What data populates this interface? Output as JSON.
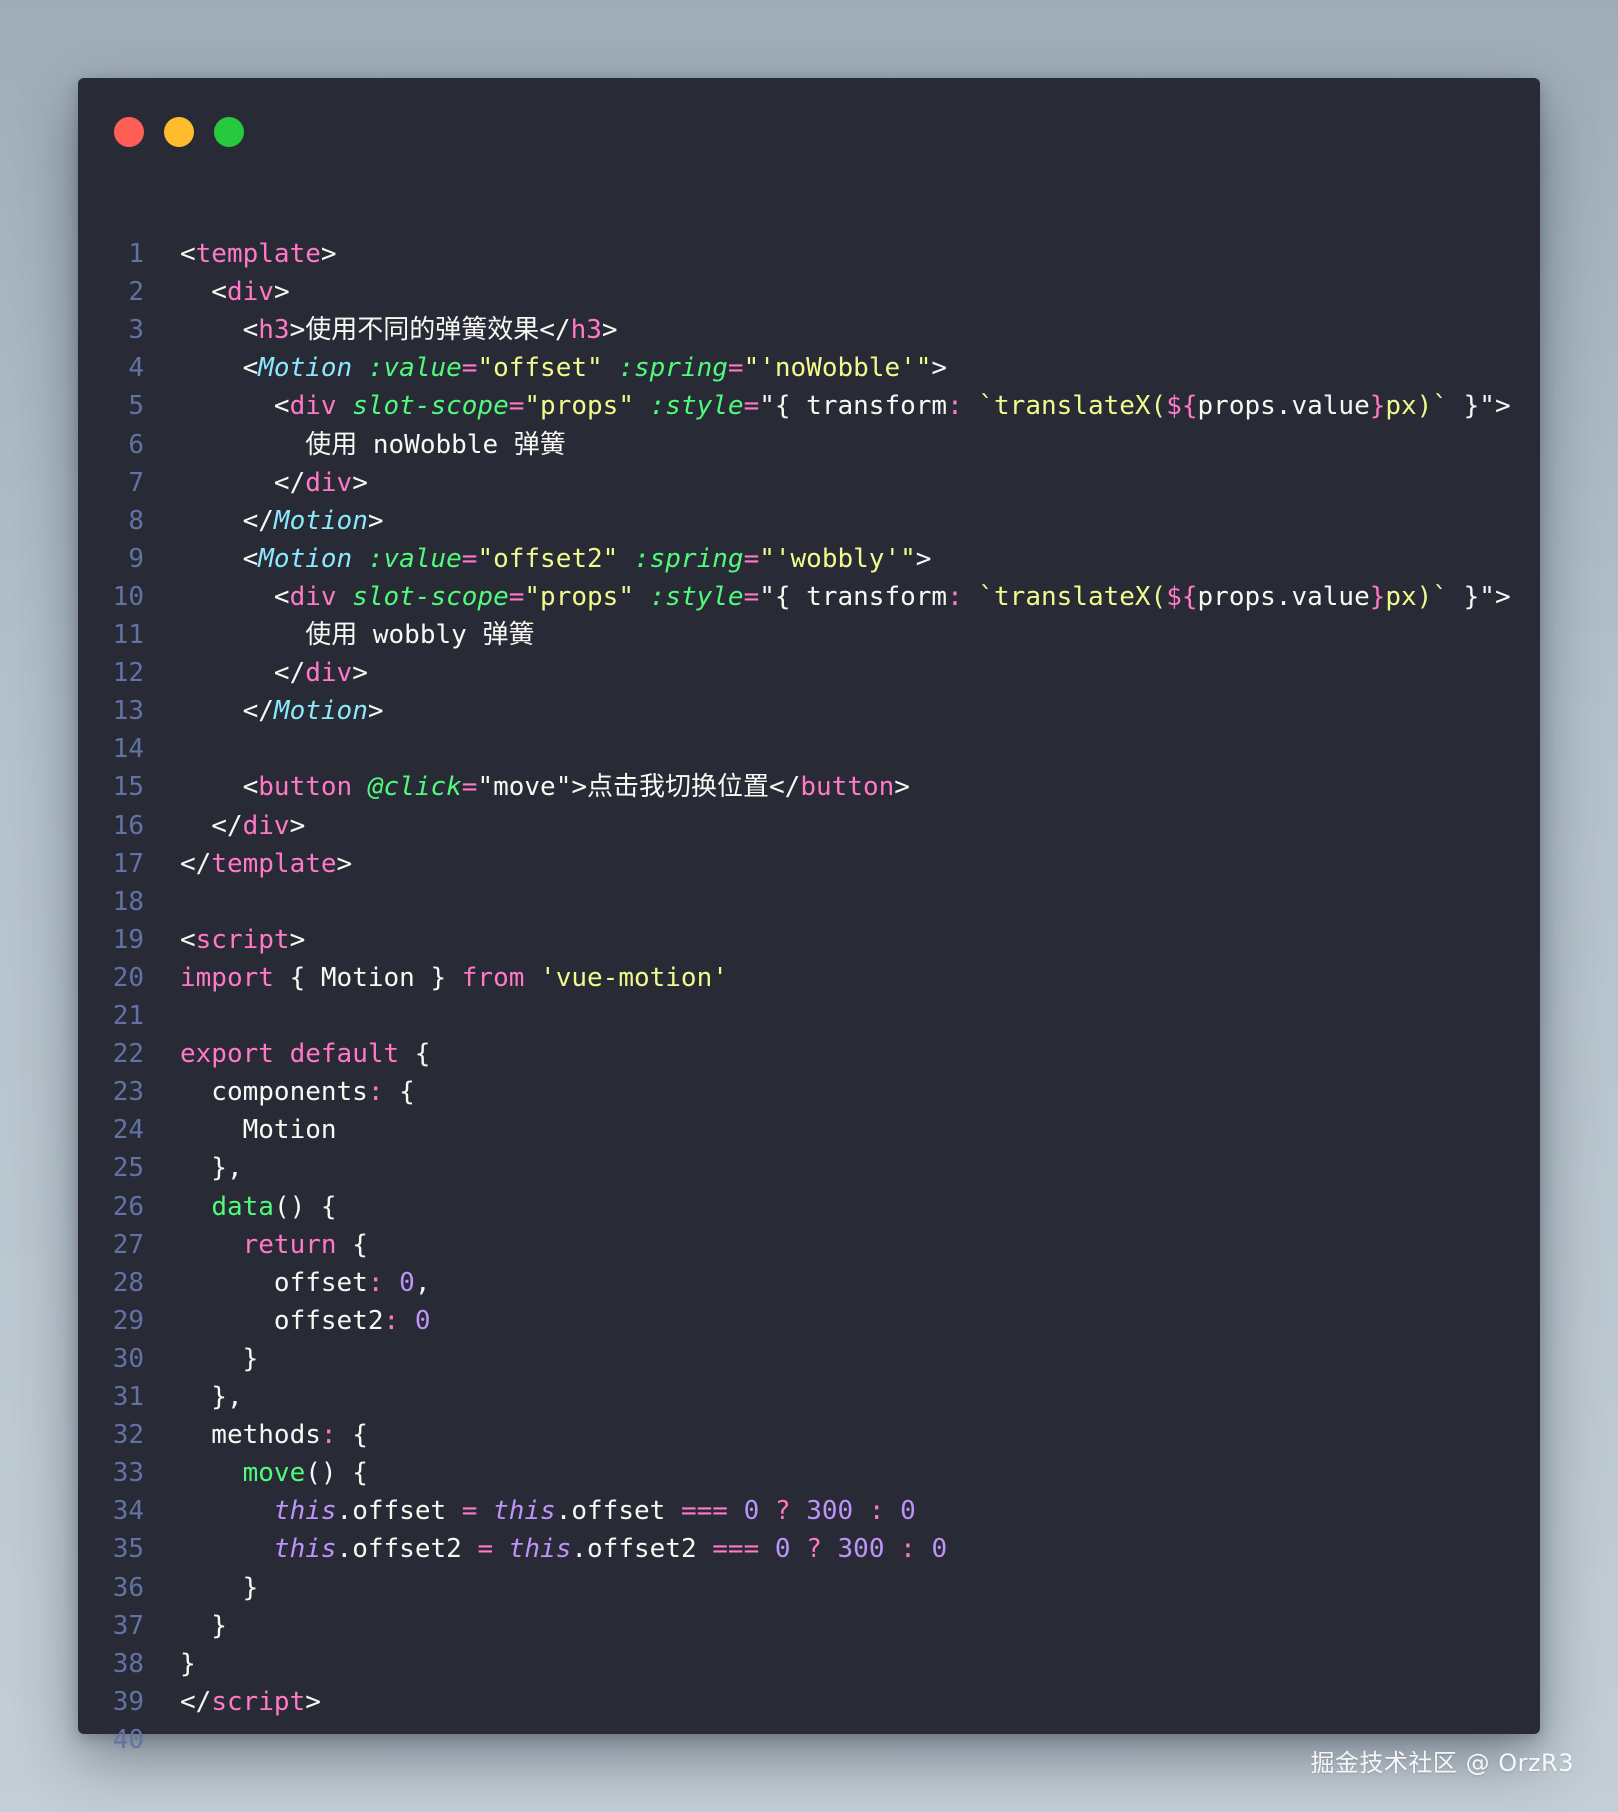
{
  "window": {
    "traffic_lights": [
      {
        "name": "close",
        "color": "#ff5f56"
      },
      {
        "name": "minimize",
        "color": "#ffbd2e"
      },
      {
        "name": "maximize",
        "color": "#27c93f"
      }
    ]
  },
  "theme": {
    "background": "#282a36",
    "line_number": "#6272a4",
    "foreground": "#f8f8f2"
  },
  "code": {
    "lines": [
      {
        "n": "1",
        "tokens": [
          [
            "plain",
            "<"
          ],
          [
            "tag",
            "template"
          ],
          [
            "plain",
            ">"
          ]
        ]
      },
      {
        "n": "2",
        "tokens": [
          [
            "plain",
            "  <"
          ],
          [
            "tag",
            "div"
          ],
          [
            "plain",
            ">"
          ]
        ]
      },
      {
        "n": "3",
        "tokens": [
          [
            "plain",
            "    <"
          ],
          [
            "tag",
            "h3"
          ],
          [
            "plain",
            ">使用不同的弹簧效果</"
          ],
          [
            "tag",
            "h3"
          ],
          [
            "plain",
            ">"
          ]
        ]
      },
      {
        "n": "4",
        "tokens": [
          [
            "plain",
            "    <"
          ],
          [
            "comp",
            "Motion"
          ],
          [
            "plain",
            " "
          ],
          [
            "attr",
            ":value"
          ],
          [
            "op",
            "="
          ],
          [
            "str",
            "\"offset\""
          ],
          [
            "plain",
            " "
          ],
          [
            "attr",
            ":spring"
          ],
          [
            "op",
            "="
          ],
          [
            "str",
            "\"'noWobble'\""
          ],
          [
            "plain",
            ">"
          ]
        ]
      },
      {
        "n": "5",
        "tokens": [
          [
            "plain",
            "      <"
          ],
          [
            "tag",
            "div"
          ],
          [
            "plain",
            " "
          ],
          [
            "attr",
            "slot-scope"
          ],
          [
            "op",
            "="
          ],
          [
            "str",
            "\"props\""
          ],
          [
            "plain",
            " "
          ],
          [
            "attr",
            ":style"
          ],
          [
            "op",
            "="
          ],
          [
            "plain",
            "\"{ transform"
          ],
          [
            "op",
            ":"
          ],
          [
            "plain",
            " "
          ],
          [
            "str",
            "`translateX("
          ],
          [
            "interp",
            "${"
          ],
          [
            "plain",
            "props.value"
          ],
          [
            "interp",
            "}"
          ],
          [
            "str",
            "px)`"
          ],
          [
            "plain",
            " }\">"
          ]
        ]
      },
      {
        "n": "6",
        "tokens": [
          [
            "plain",
            "        使用 noWobble 弹簧"
          ]
        ]
      },
      {
        "n": "7",
        "tokens": [
          [
            "plain",
            "      </"
          ],
          [
            "tag",
            "div"
          ],
          [
            "plain",
            ">"
          ]
        ]
      },
      {
        "n": "8",
        "tokens": [
          [
            "plain",
            "    </"
          ],
          [
            "comp",
            "Motion"
          ],
          [
            "plain",
            ">"
          ]
        ]
      },
      {
        "n": "9",
        "tokens": [
          [
            "plain",
            "    <"
          ],
          [
            "comp",
            "Motion"
          ],
          [
            "plain",
            " "
          ],
          [
            "attr",
            ":value"
          ],
          [
            "op",
            "="
          ],
          [
            "str",
            "\"offset2\""
          ],
          [
            "plain",
            " "
          ],
          [
            "attr",
            ":spring"
          ],
          [
            "op",
            "="
          ],
          [
            "str",
            "\"'wobbly'\""
          ],
          [
            "plain",
            ">"
          ]
        ]
      },
      {
        "n": "10",
        "tokens": [
          [
            "plain",
            "      <"
          ],
          [
            "tag",
            "div"
          ],
          [
            "plain",
            " "
          ],
          [
            "attr",
            "slot-scope"
          ],
          [
            "op",
            "="
          ],
          [
            "str",
            "\"props\""
          ],
          [
            "plain",
            " "
          ],
          [
            "attr",
            ":style"
          ],
          [
            "op",
            "="
          ],
          [
            "plain",
            "\"{ transform"
          ],
          [
            "op",
            ":"
          ],
          [
            "plain",
            " "
          ],
          [
            "str",
            "`translateX("
          ],
          [
            "interp",
            "${"
          ],
          [
            "plain",
            "props.value"
          ],
          [
            "interp",
            "}"
          ],
          [
            "str",
            "px)`"
          ],
          [
            "plain",
            " }\">"
          ]
        ]
      },
      {
        "n": "11",
        "tokens": [
          [
            "plain",
            "        使用 wobbly 弹簧"
          ]
        ]
      },
      {
        "n": "12",
        "tokens": [
          [
            "plain",
            "      </"
          ],
          [
            "tag",
            "div"
          ],
          [
            "plain",
            ">"
          ]
        ]
      },
      {
        "n": "13",
        "tokens": [
          [
            "plain",
            "    </"
          ],
          [
            "comp",
            "Motion"
          ],
          [
            "plain",
            ">"
          ]
        ]
      },
      {
        "n": "14",
        "tokens": []
      },
      {
        "n": "15",
        "tokens": [
          [
            "plain",
            "    <"
          ],
          [
            "tag",
            "button"
          ],
          [
            "plain",
            " "
          ],
          [
            "attr",
            "@click"
          ],
          [
            "op",
            "="
          ],
          [
            "plain",
            "\"move\">点击我切换位置</"
          ],
          [
            "tag",
            "button"
          ],
          [
            "plain",
            ">"
          ]
        ]
      },
      {
        "n": "16",
        "tokens": [
          [
            "plain",
            "  </"
          ],
          [
            "tag",
            "div"
          ],
          [
            "plain",
            ">"
          ]
        ]
      },
      {
        "n": "17",
        "tokens": [
          [
            "plain",
            "</"
          ],
          [
            "tag",
            "template"
          ],
          [
            "plain",
            ">"
          ]
        ]
      },
      {
        "n": "18",
        "tokens": []
      },
      {
        "n": "19",
        "tokens": [
          [
            "plain",
            "<"
          ],
          [
            "tag",
            "script"
          ],
          [
            "plain",
            ">"
          ]
        ]
      },
      {
        "n": "20",
        "tokens": [
          [
            "kw",
            "import"
          ],
          [
            "plain",
            " { Motion } "
          ],
          [
            "kw",
            "from"
          ],
          [
            "plain",
            " "
          ],
          [
            "str",
            "'vue-motion'"
          ]
        ]
      },
      {
        "n": "21",
        "tokens": []
      },
      {
        "n": "22",
        "tokens": [
          [
            "kw",
            "export"
          ],
          [
            "plain",
            " "
          ],
          [
            "kw",
            "default"
          ],
          [
            "plain",
            " {"
          ]
        ]
      },
      {
        "n": "23",
        "tokens": [
          [
            "plain",
            "  components"
          ],
          [
            "op",
            ":"
          ],
          [
            "plain",
            " {"
          ]
        ]
      },
      {
        "n": "24",
        "tokens": [
          [
            "plain",
            "    Motion"
          ]
        ]
      },
      {
        "n": "25",
        "tokens": [
          [
            "plain",
            "  },"
          ]
        ]
      },
      {
        "n": "26",
        "tokens": [
          [
            "plain",
            "  "
          ],
          [
            "fn",
            "data"
          ],
          [
            "plain",
            "() {"
          ]
        ]
      },
      {
        "n": "27",
        "tokens": [
          [
            "plain",
            "    "
          ],
          [
            "kw",
            "return"
          ],
          [
            "plain",
            " {"
          ]
        ]
      },
      {
        "n": "28",
        "tokens": [
          [
            "plain",
            "      offset"
          ],
          [
            "op",
            ":"
          ],
          [
            "plain",
            " "
          ],
          [
            "num",
            "0"
          ],
          [
            "plain",
            ","
          ]
        ]
      },
      {
        "n": "29",
        "tokens": [
          [
            "plain",
            "      offset2"
          ],
          [
            "op",
            ":"
          ],
          [
            "plain",
            " "
          ],
          [
            "num",
            "0"
          ]
        ]
      },
      {
        "n": "30",
        "tokens": [
          [
            "plain",
            "    }"
          ]
        ]
      },
      {
        "n": "31",
        "tokens": [
          [
            "plain",
            "  },"
          ]
        ]
      },
      {
        "n": "32",
        "tokens": [
          [
            "plain",
            "  methods"
          ],
          [
            "op",
            ":"
          ],
          [
            "plain",
            " {"
          ]
        ]
      },
      {
        "n": "33",
        "tokens": [
          [
            "plain",
            "    "
          ],
          [
            "fn",
            "move"
          ],
          [
            "plain",
            "() {"
          ]
        ]
      },
      {
        "n": "34",
        "tokens": [
          [
            "plain",
            "      "
          ],
          [
            "this",
            "this"
          ],
          [
            "plain",
            ".offset "
          ],
          [
            "op",
            "="
          ],
          [
            "plain",
            " "
          ],
          [
            "this",
            "this"
          ],
          [
            "plain",
            ".offset "
          ],
          [
            "op",
            "==="
          ],
          [
            "plain",
            " "
          ],
          [
            "num",
            "0"
          ],
          [
            "plain",
            " "
          ],
          [
            "op",
            "?"
          ],
          [
            "plain",
            " "
          ],
          [
            "num",
            "300"
          ],
          [
            "plain",
            " "
          ],
          [
            "op",
            ":"
          ],
          [
            "plain",
            " "
          ],
          [
            "num",
            "0"
          ]
        ]
      },
      {
        "n": "35",
        "tokens": [
          [
            "plain",
            "      "
          ],
          [
            "this",
            "this"
          ],
          [
            "plain",
            ".offset2 "
          ],
          [
            "op",
            "="
          ],
          [
            "plain",
            " "
          ],
          [
            "this",
            "this"
          ],
          [
            "plain",
            ".offset2 "
          ],
          [
            "op",
            "==="
          ],
          [
            "plain",
            " "
          ],
          [
            "num",
            "0"
          ],
          [
            "plain",
            " "
          ],
          [
            "op",
            "?"
          ],
          [
            "plain",
            " "
          ],
          [
            "num",
            "300"
          ],
          [
            "plain",
            " "
          ],
          [
            "op",
            ":"
          ],
          [
            "plain",
            " "
          ],
          [
            "num",
            "0"
          ]
        ]
      },
      {
        "n": "36",
        "tokens": [
          [
            "plain",
            "    }"
          ]
        ]
      },
      {
        "n": "37",
        "tokens": [
          [
            "plain",
            "  }"
          ]
        ]
      },
      {
        "n": "38",
        "tokens": [
          [
            "plain",
            "}"
          ]
        ]
      },
      {
        "n": "39",
        "tokens": [
          [
            "plain",
            "</"
          ],
          [
            "tag",
            "script"
          ],
          [
            "plain",
            ">"
          ]
        ]
      },
      {
        "n": "40",
        "tokens": []
      }
    ]
  },
  "watermark": "掘金技术社区 @ OrzR3"
}
